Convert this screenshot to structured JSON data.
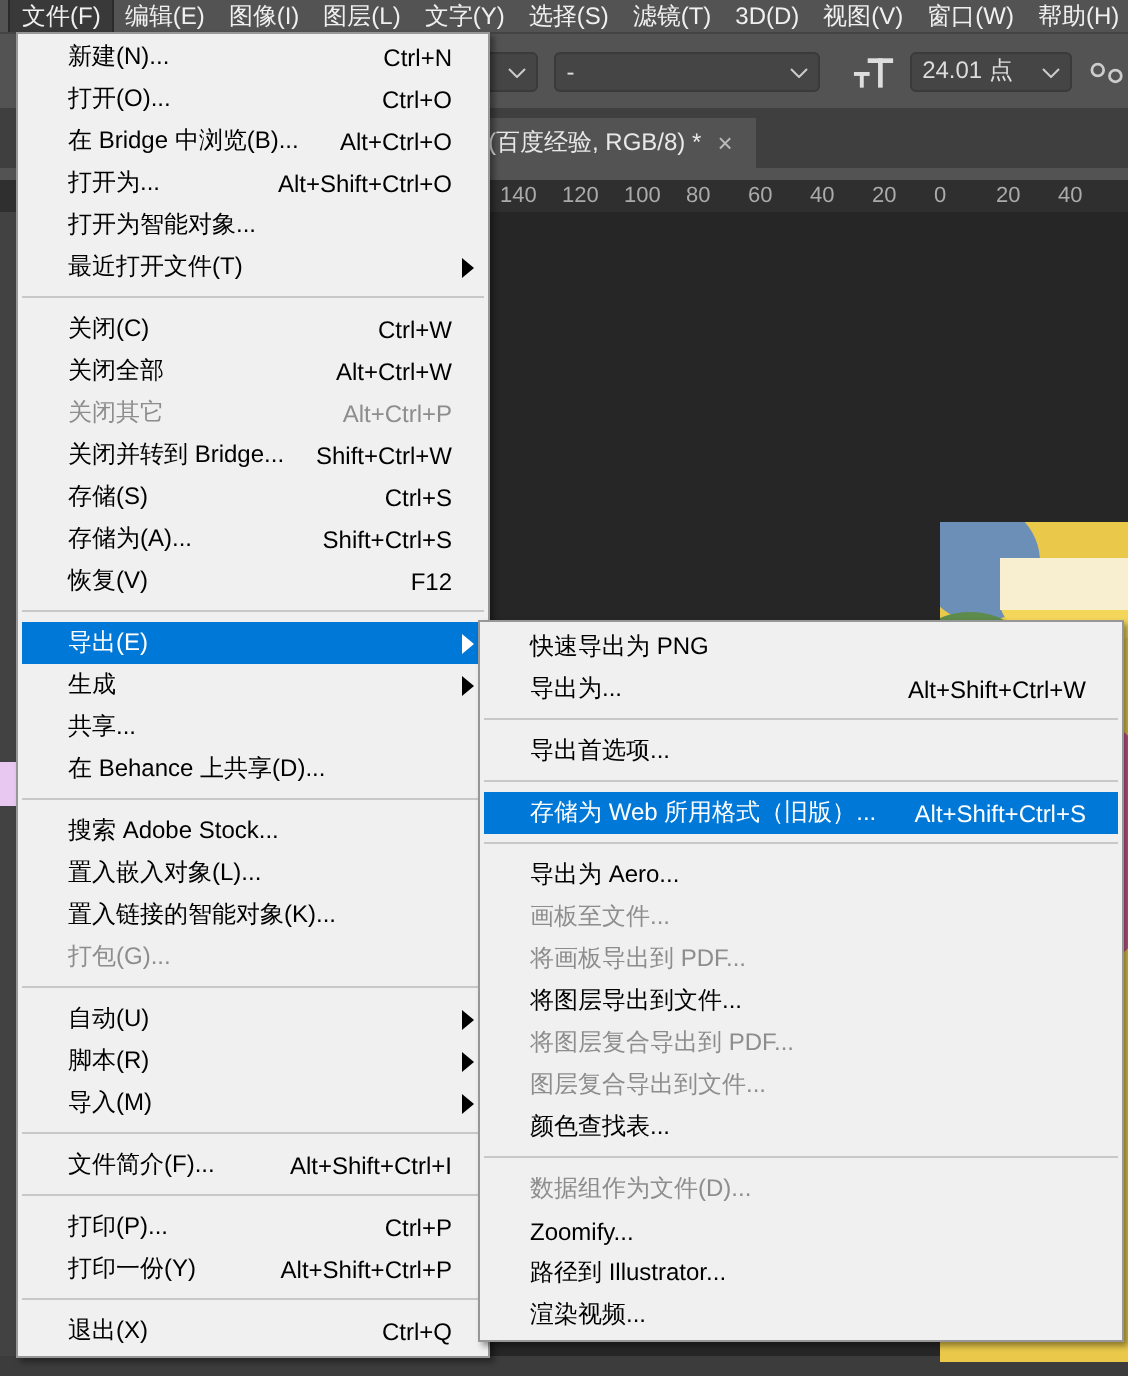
{
  "menu_bar": [
    {
      "label": "文件(F)",
      "selected": true
    },
    {
      "label": "编辑(E)",
      "selected": false
    },
    {
      "label": "图像(I)",
      "selected": false
    },
    {
      "label": "图层(L)",
      "selected": false
    },
    {
      "label": "文字(Y)",
      "selected": false
    },
    {
      "label": "选择(S)",
      "selected": false
    },
    {
      "label": "滤镜(T)",
      "selected": false
    },
    {
      "label": "3D(D)",
      "selected": false
    },
    {
      "label": "视图(V)",
      "selected": false
    },
    {
      "label": "窗口(W)",
      "selected": false
    },
    {
      "label": "帮助(H)",
      "selected": false
    }
  ],
  "options_bar": {
    "style_dropdown": {
      "value": "-"
    },
    "font_size": {
      "value": "24.01 点"
    }
  },
  "document_tab": {
    "title": "(百度经验, RGB/8) *",
    "close": "×"
  },
  "ruler": [
    "140",
    "120",
    "100",
    "80",
    "60",
    "40",
    "20",
    "0",
    "20",
    "40"
  ],
  "file_menu": [
    {
      "kind": "command",
      "label": "新建(N)...",
      "shortcut": "Ctrl+N",
      "disabled": false,
      "selected": false
    },
    {
      "kind": "command",
      "label": "打开(O)...",
      "shortcut": "Ctrl+O",
      "disabled": false,
      "selected": false
    },
    {
      "kind": "command",
      "label": "在 Bridge 中浏览(B)...",
      "shortcut": "Alt+Ctrl+O",
      "disabled": false,
      "selected": false
    },
    {
      "kind": "command",
      "label": "打开为...",
      "shortcut": "Alt+Shift+Ctrl+O",
      "disabled": false,
      "selected": false
    },
    {
      "kind": "command",
      "label": "打开为智能对象...",
      "disabled": false,
      "selected": false
    },
    {
      "kind": "submenu",
      "label": "最近打开文件(T)",
      "disabled": false,
      "selected": false
    },
    {
      "kind": "separator"
    },
    {
      "kind": "command",
      "label": "关闭(C)",
      "shortcut": "Ctrl+W",
      "disabled": false,
      "selected": false
    },
    {
      "kind": "command",
      "label": "关闭全部",
      "shortcut": "Alt+Ctrl+W",
      "disabled": false,
      "selected": false
    },
    {
      "kind": "command",
      "label": "关闭其它",
      "shortcut": "Alt+Ctrl+P",
      "disabled": true,
      "selected": false
    },
    {
      "kind": "command",
      "label": "关闭并转到 Bridge...",
      "shortcut": "Shift+Ctrl+W",
      "disabled": false,
      "selected": false
    },
    {
      "kind": "command",
      "label": "存储(S)",
      "shortcut": "Ctrl+S",
      "disabled": false,
      "selected": false
    },
    {
      "kind": "command",
      "label": "存储为(A)...",
      "shortcut": "Shift+Ctrl+S",
      "disabled": false,
      "selected": false
    },
    {
      "kind": "command",
      "label": "恢复(V)",
      "shortcut": "F12",
      "disabled": false,
      "selected": false
    },
    {
      "kind": "separator"
    },
    {
      "kind": "submenu",
      "label": "导出(E)",
      "disabled": false,
      "selected": true
    },
    {
      "kind": "submenu",
      "label": "生成",
      "disabled": false,
      "selected": false
    },
    {
      "kind": "command",
      "label": "共享...",
      "disabled": false,
      "selected": false
    },
    {
      "kind": "command",
      "label": "在 Behance 上共享(D)...",
      "disabled": false,
      "selected": false
    },
    {
      "kind": "separator"
    },
    {
      "kind": "command",
      "label": "搜索 Adobe Stock...",
      "disabled": false,
      "selected": false
    },
    {
      "kind": "command",
      "label": "置入嵌入对象(L)...",
      "disabled": false,
      "selected": false
    },
    {
      "kind": "command",
      "label": "置入链接的智能对象(K)...",
      "disabled": false,
      "selected": false
    },
    {
      "kind": "command",
      "label": "打包(G)...",
      "disabled": true,
      "selected": false
    },
    {
      "kind": "separator"
    },
    {
      "kind": "submenu",
      "label": "自动(U)",
      "disabled": false,
      "selected": false
    },
    {
      "kind": "submenu",
      "label": "脚本(R)",
      "disabled": false,
      "selected": false
    },
    {
      "kind": "submenu",
      "label": "导入(M)",
      "disabled": false,
      "selected": false
    },
    {
      "kind": "separator"
    },
    {
      "kind": "command",
      "label": "文件简介(F)...",
      "shortcut": "Alt+Shift+Ctrl+I",
      "disabled": false,
      "selected": false
    },
    {
      "kind": "separator"
    },
    {
      "kind": "command",
      "label": "打印(P)...",
      "shortcut": "Ctrl+P",
      "disabled": false,
      "selected": false
    },
    {
      "kind": "command",
      "label": "打印一份(Y)",
      "shortcut": "Alt+Shift+Ctrl+P",
      "disabled": false,
      "selected": false
    },
    {
      "kind": "separator"
    },
    {
      "kind": "command",
      "label": "退出(X)",
      "shortcut": "Ctrl+Q",
      "disabled": false,
      "selected": false
    }
  ],
  "export_submenu": [
    {
      "kind": "command",
      "label": "快速导出为 PNG",
      "disabled": false,
      "selected": false
    },
    {
      "kind": "command",
      "label": "导出为...",
      "shortcut": "Alt+Shift+Ctrl+W",
      "disabled": false,
      "selected": false
    },
    {
      "kind": "separator"
    },
    {
      "kind": "command",
      "label": "导出首选项...",
      "disabled": false,
      "selected": false
    },
    {
      "kind": "separator"
    },
    {
      "kind": "command",
      "label": "存储为 Web 所用格式（旧版）...",
      "shortcut": "Alt+Shift+Ctrl+S",
      "disabled": false,
      "selected": true
    },
    {
      "kind": "separator"
    },
    {
      "kind": "command",
      "label": "导出为 Aero...",
      "disabled": false,
      "selected": false
    },
    {
      "kind": "command",
      "label": "画板至文件...",
      "disabled": true,
      "selected": false
    },
    {
      "kind": "command",
      "label": "将画板导出到 PDF...",
      "disabled": true,
      "selected": false
    },
    {
      "kind": "command",
      "label": "将图层导出到文件...",
      "disabled": false,
      "selected": false
    },
    {
      "kind": "command",
      "label": "将图层复合导出到 PDF...",
      "disabled": true,
      "selected": false
    },
    {
      "kind": "command",
      "label": "图层复合导出到文件...",
      "disabled": true,
      "selected": false
    },
    {
      "kind": "command",
      "label": "颜色查找表...",
      "disabled": false,
      "selected": false
    },
    {
      "kind": "separator"
    },
    {
      "kind": "command",
      "label": "数据组作为文件(D)...",
      "disabled": true,
      "selected": false
    },
    {
      "kind": "command",
      "label": "Zoomify...",
      "disabled": false,
      "selected": false
    },
    {
      "kind": "command",
      "label": "路径到 Illustrator...",
      "disabled": false,
      "selected": false
    },
    {
      "kind": "command",
      "label": "渲染视频...",
      "disabled": false,
      "selected": false
    }
  ]
}
